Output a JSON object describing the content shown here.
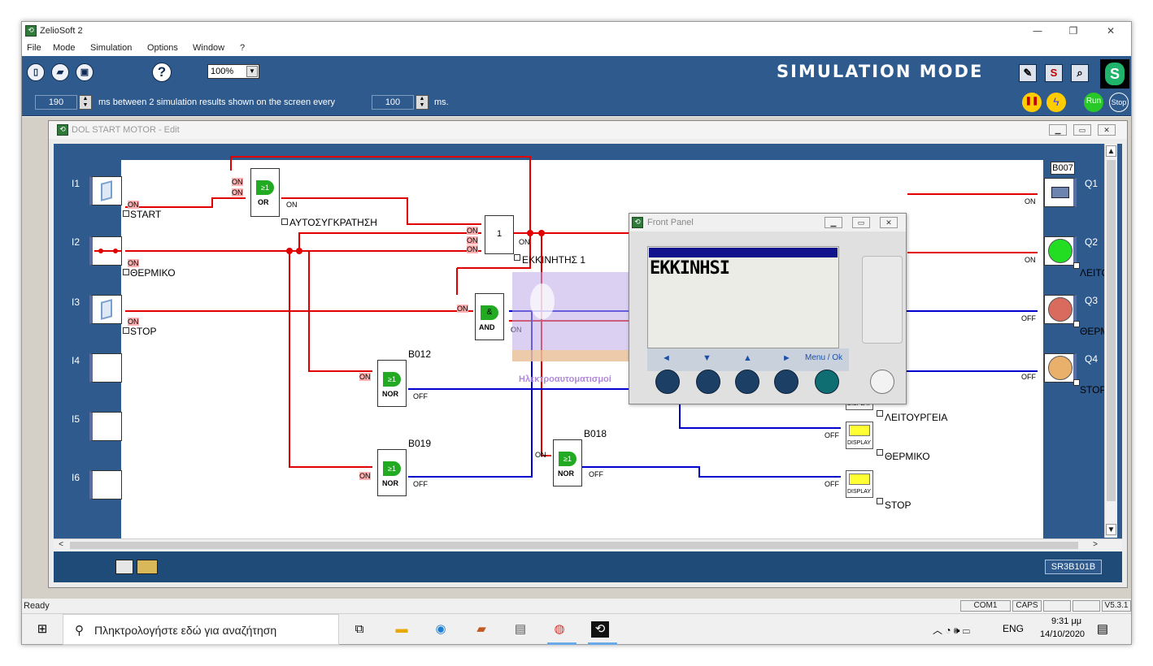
{
  "window": {
    "title": "ZelioSoft 2"
  },
  "menu": [
    "File",
    "Mode",
    "Simulation",
    "Options",
    "Window",
    "?"
  ],
  "toolbar": {
    "zoom": "100%",
    "help_label": "?",
    "mode_banner": "SIMULATION MODE",
    "s_label": "S"
  },
  "simbar": {
    "interval_value": "190",
    "interval_text": "ms between 2 simulation results shown on the screen every",
    "refresh_value": "100",
    "unit": "ms.",
    "run_label": "Run",
    "stop_label": "Stop"
  },
  "edit_window": {
    "title": "DOL START MOTOR - Edit"
  },
  "inputs": [
    {
      "id": "I1",
      "state": "ON",
      "label": "START"
    },
    {
      "id": "I2",
      "state": "ON",
      "label": "ΘΕΡΜΙΚΟ"
    },
    {
      "id": "I3",
      "state": "ON",
      "label": "STOP"
    },
    {
      "id": "I4"
    },
    {
      "id": "I5"
    },
    {
      "id": "I6"
    }
  ],
  "outputs": [
    {
      "id": "Q1",
      "block": "B007",
      "state": "ON"
    },
    {
      "id": "Q2",
      "state": "ON",
      "label": "ΛΕΙΤΟ"
    },
    {
      "id": "Q3",
      "state": "OFF",
      "label": "ΘΕΡΜ"
    },
    {
      "id": "Q4",
      "state": "OFF",
      "label": "STOP"
    }
  ],
  "blocks": {
    "or": {
      "type": "OR",
      "symbol": "≥1",
      "in1": "ON",
      "in2": "ON",
      "out": "ON",
      "label": "ΑΥΤΟΣΥΓΚΡΑΤΗΣΗ"
    },
    "coil": {
      "symbol": "1",
      "in1": "ON",
      "in2": "ON",
      "in3": "ON",
      "out": "ON",
      "label": "ΕΚΚΙΝΗΤΗΣ 1"
    },
    "and": {
      "type": "AND",
      "symbol": "&",
      "in1": "ON",
      "out": "ON"
    },
    "nor1": {
      "id": "B012",
      "type": "NOR",
      "in1": "ON",
      "out": "OFF"
    },
    "nor2": {
      "id": "B019",
      "type": "NOR",
      "in1": "ON",
      "out": "OFF"
    },
    "nor3": {
      "id": "B018",
      "type": "NOR",
      "in1": "ON",
      "out": "OFF"
    }
  },
  "displays": [
    {
      "state": "ON",
      "tag": "DISPLAY",
      "label": "ΛΕΙΤΟΥΡΓΕΙΑ"
    },
    {
      "state": "OFF",
      "tag": "DISPLAY",
      "label": "ΘΕΡΜΙΚΟ"
    },
    {
      "state": "OFF",
      "tag": "DISPLAY",
      "label": "STOP"
    }
  ],
  "watermark": {
    "caption": "Ηλεκτροαυτοματισμοί"
  },
  "front_panel": {
    "title": "Front Panel",
    "lcd_text": "EKKINHSI",
    "nav": [
      "◄",
      "▼",
      "▲",
      "►"
    ],
    "menu_ok": "Menu / Ok"
  },
  "device": "SR3B101B",
  "statusbar": {
    "text": "Ready",
    "port": "COM1",
    "caps": "CAPS",
    "version": "V5.3.1"
  },
  "taskbar": {
    "search_placeholder": "Πληκτρολογήστε εδώ για αναζήτηση",
    "lang": "ENG",
    "time": "9:31 μμ",
    "date": "14/10/2020"
  },
  "colors": {
    "on_wire": "#e00000",
    "off_wire": "#0000cc",
    "toolbar_blue": "#2e5a8e",
    "ok_green": "#22dd22"
  }
}
